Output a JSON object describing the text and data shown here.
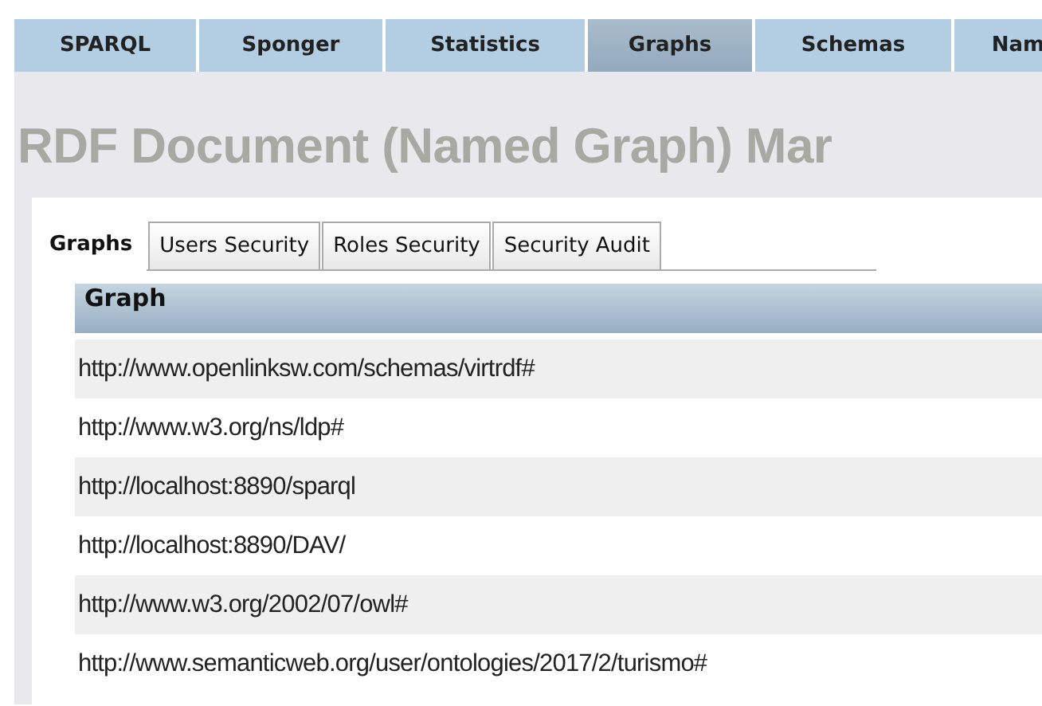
{
  "nav_tabs": [
    {
      "label": "SPARQL",
      "selected": false
    },
    {
      "label": "Sponger",
      "selected": false
    },
    {
      "label": "Statistics",
      "selected": false
    },
    {
      "label": "Graphs",
      "selected": true
    },
    {
      "label": "Schemas",
      "selected": false
    },
    {
      "label": "Nam",
      "selected": false
    }
  ],
  "heading": "RDF Document (Named Graph) Mar",
  "sub_tabs": [
    {
      "label": "Graphs",
      "selected": true
    },
    {
      "label": "Users Security",
      "selected": false
    },
    {
      "label": "Roles Security",
      "selected": false
    },
    {
      "label": "Security Audit",
      "selected": false
    }
  ],
  "table": {
    "columns": [
      "Graph"
    ],
    "rows": [
      "http://www.openlinksw.com/schemas/virtrdf#",
      "http://www.w3.org/ns/ldp#",
      "http://localhost:8890/sparql",
      "http://localhost:8890/DAV/",
      "http://www.w3.org/2002/07/owl#",
      "http://www.semanticweb.org/user/ontologies/2017/2/turismo#"
    ]
  }
}
